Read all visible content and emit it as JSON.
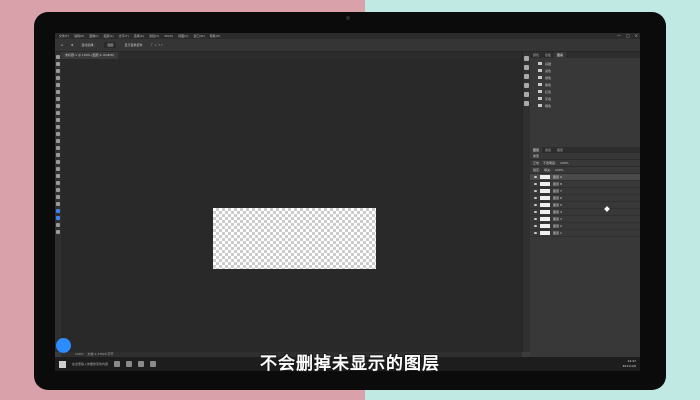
{
  "menubar": {
    "items": [
      "文件(F)",
      "编辑(E)",
      "图像(I)",
      "图层(L)",
      "文字(Y)",
      "选择(S)",
      "滤镜(T)",
      "3D(D)",
      "视图(V)",
      "窗口(W)",
      "帮助(H)"
    ]
  },
  "options_bar": {
    "auto_select": "自动选择：",
    "layer_select": "图层",
    "transform": "显示变换控件"
  },
  "document_tab": {
    "title": "未标题-1 @ 100% (图层 9, RGB/8)"
  },
  "status_bar": {
    "zoom": "100%",
    "info": "文档:1.37M/0 字节"
  },
  "panels": {
    "tabs": [
      "颜色",
      "色板",
      "图案"
    ],
    "history_items": [
      "基础",
      "蓝色",
      "绿色",
      "紫色",
      "红色",
      "灰色",
      "暗色"
    ],
    "layers_tabs": [
      "图层",
      "通道",
      "路径"
    ],
    "filter_label": "类型",
    "mode_label": "正常",
    "opacity_label": "不透明度:",
    "opacity_value": "100%",
    "lock_label": "锁定:",
    "fill_label": "填充:",
    "fill_value": "100%",
    "layers": [
      "图层 9",
      "图层 8",
      "图层 7",
      "图层 6",
      "图层 5",
      "图层 4",
      "图层 3",
      "图层 2",
      "图层 1"
    ]
  },
  "taskbar": {
    "time": "14:47",
    "date": "2021/1/6",
    "search_text": "在这里输入你要搜索的内容"
  },
  "caption": {
    "text": "不会删掉未显示的图层"
  },
  "colors": {
    "accent": "#2d8cff",
    "bg_left": "#d9a1a9",
    "bg_right": "#bfe9e2"
  }
}
